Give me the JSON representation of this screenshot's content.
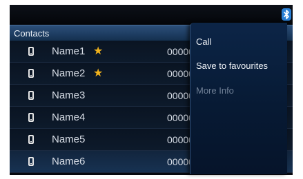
{
  "header": {
    "title": "Contacts"
  },
  "status": {
    "icon": "bluetooth-icon",
    "accent": "#2a7fd4"
  },
  "contacts": [
    {
      "name": "Name1",
      "favourite": true,
      "number": "00000"
    },
    {
      "name": "Name2",
      "favourite": true,
      "number": "00000"
    },
    {
      "name": "Name3",
      "favourite": false,
      "number": "00000"
    },
    {
      "name": "Name4",
      "favourite": false,
      "number": "00000"
    },
    {
      "name": "Name5",
      "favourite": false,
      "number": "00000"
    },
    {
      "name": "Name6",
      "favourite": false,
      "number": "00000"
    }
  ],
  "star_glyph": "★",
  "menu": {
    "call": "Call",
    "save_favourites": "Save to favourites",
    "more_info": "More Info"
  }
}
